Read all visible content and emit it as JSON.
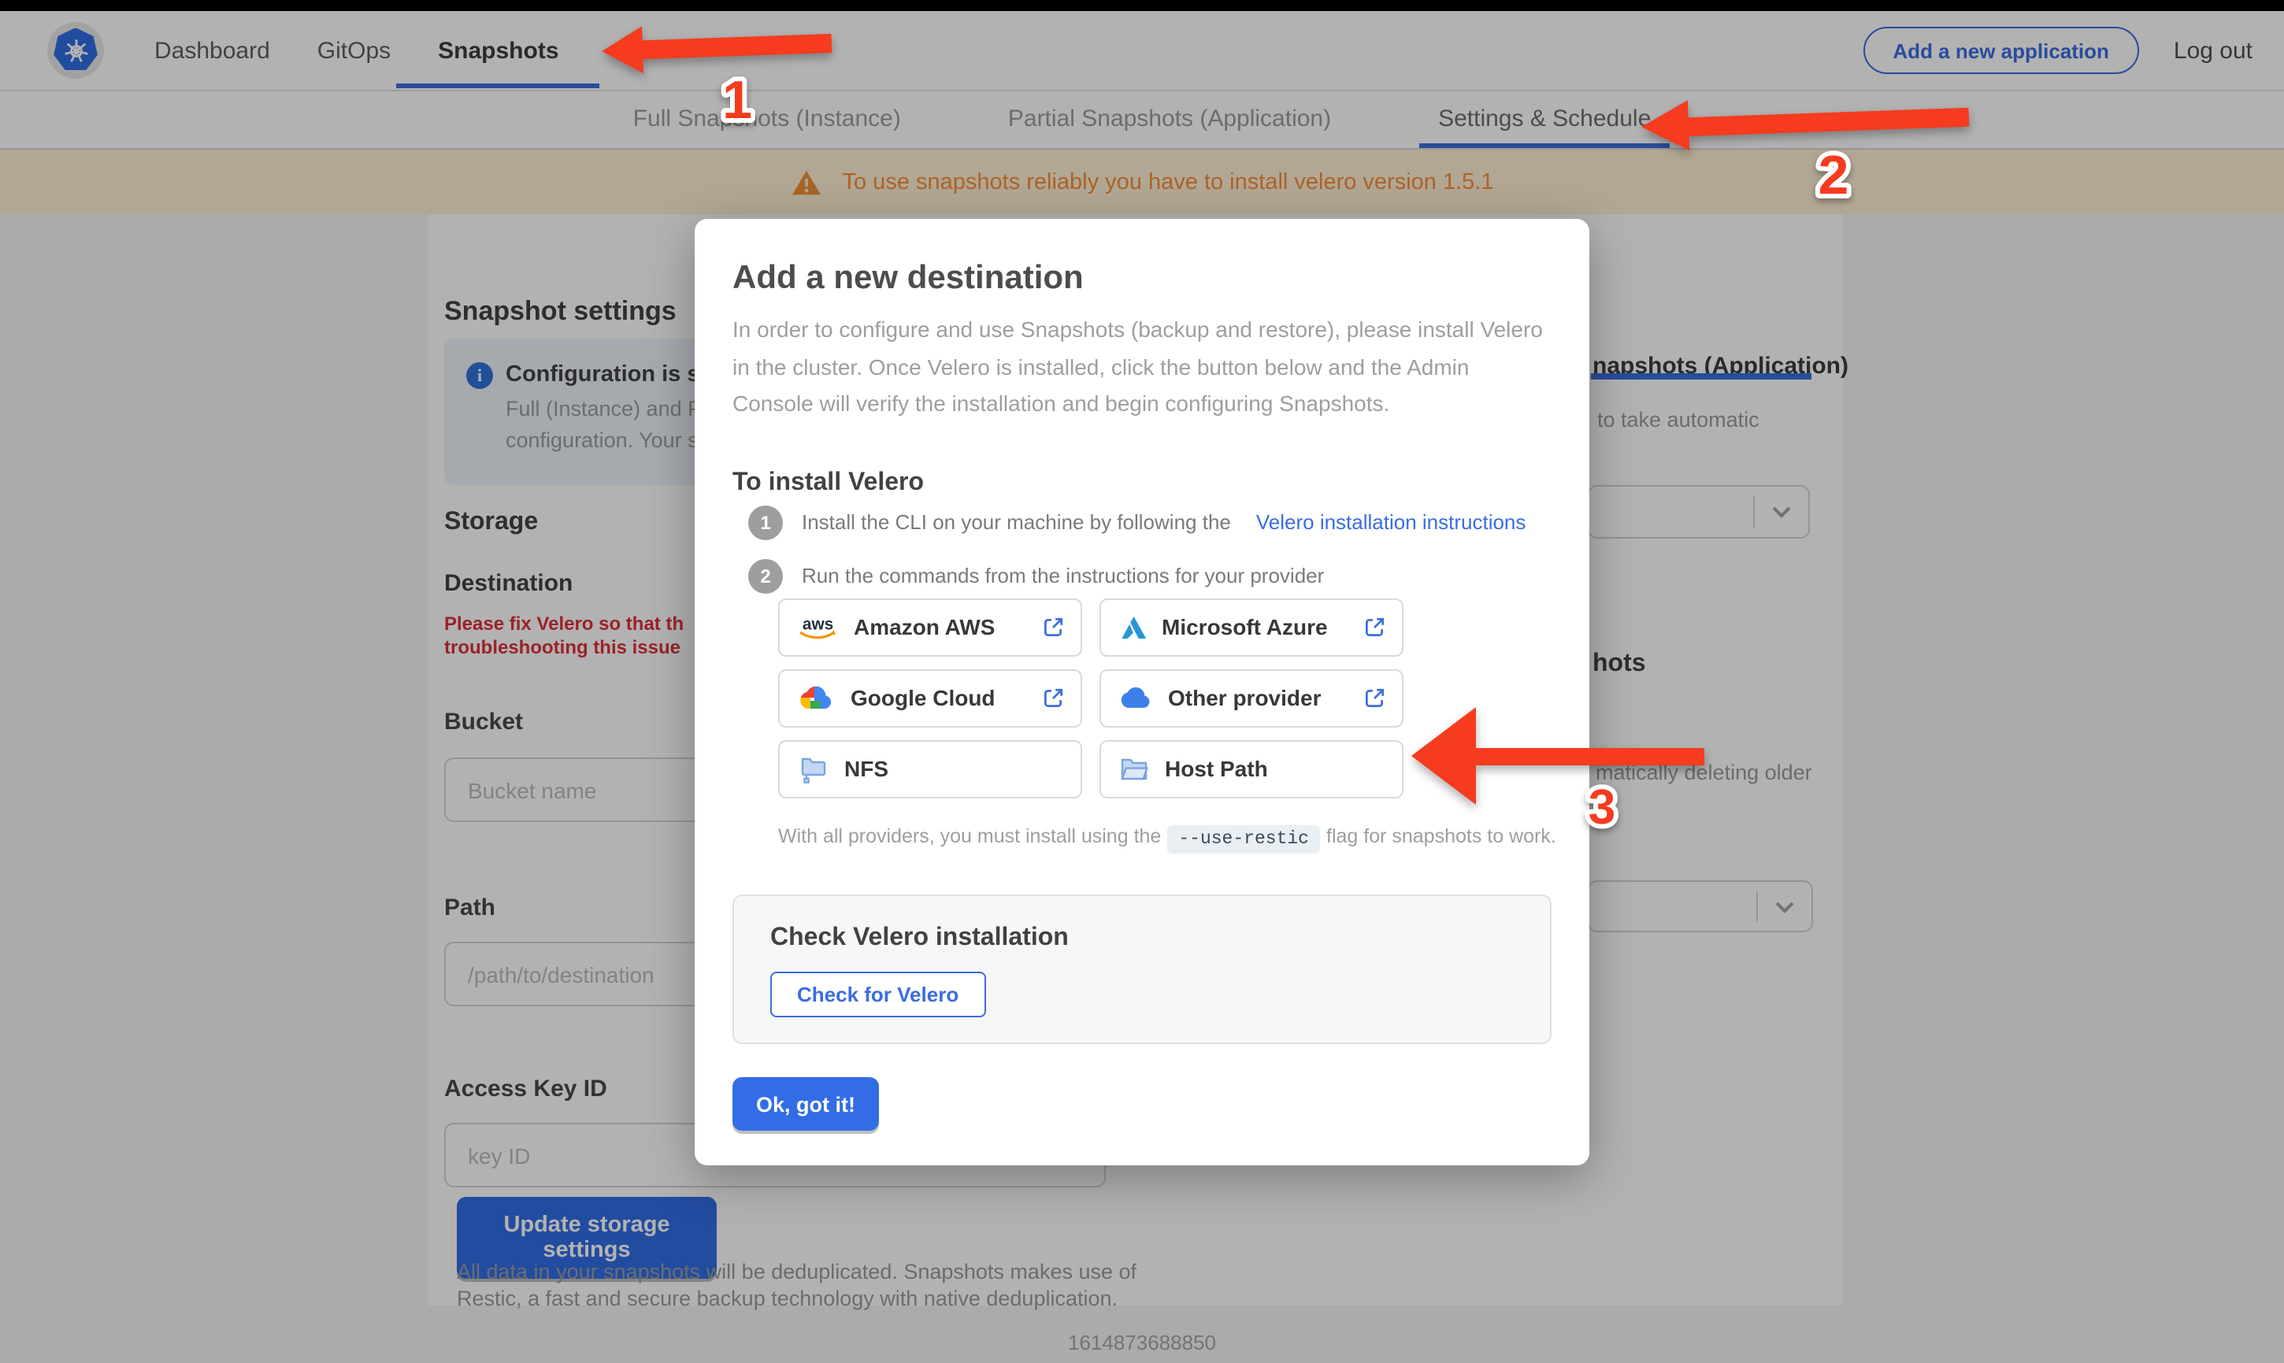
{
  "topnav": {
    "items": [
      {
        "label": "Dashboard"
      },
      {
        "label": "GitOps"
      },
      {
        "label": "Snapshots"
      }
    ],
    "active": "Snapshots",
    "add_application_label": "Add a new application",
    "logout_label": "Log out"
  },
  "tabs": {
    "items": [
      {
        "label": "Full Snapshots (Instance)"
      },
      {
        "label": "Partial Snapshots (Application)"
      },
      {
        "label": "Settings & Schedule"
      }
    ],
    "active": "Settings & Schedule"
  },
  "banner": {
    "text": "To use snapshots reliably you have to install velero version 1.5.1"
  },
  "settings_page": {
    "title": "Snapshot settings",
    "info_box": {
      "title_fragment": "Configuration is sh",
      "line1_fragment": "Full (Instance) and Parti",
      "line2_fragment": "configuration. Your stor"
    },
    "storage_heading": "Storage",
    "destination_heading": "Destination",
    "error_line1": "Please fix Velero so that th",
    "error_line2": "troubleshooting this issue",
    "fields": {
      "bucket_label": "Bucket",
      "bucket_placeholder": "Bucket name",
      "path_label": "Path",
      "path_placeholder": "/path/to/destination",
      "access_key_label": "Access Key ID",
      "access_key_placeholder": "key ID"
    },
    "update_button_label": "Update storage settings",
    "dedup_line1": "All data in your snapshots will be deduplicated. Snapshots makes use of",
    "dedup_line2": "Restic, a fast and secure backup technology with native deduplication.",
    "schedule_fragments": {
      "tab_fragment": "napshots (Application)",
      "interval_fragment": "to take automatic",
      "retention_heading_fragment": "hots",
      "retention_fragment": "matically deleting older"
    }
  },
  "modal": {
    "title": "Add a new destination",
    "body": "In order to configure and use Snapshots (backup and restore), please install Velero in the cluster. Once Velero is installed, click the button below and the Admin Console will verify the installation and begin configuring Snapshots.",
    "install_heading": "To install Velero",
    "steps": [
      {
        "number": "1",
        "text": "Install the CLI on your machine by following the",
        "link": "Velero installation instructions"
      },
      {
        "number": "2",
        "text": "Run the commands from the instructions for your provider"
      }
    ],
    "providers": [
      {
        "label": "Amazon AWS"
      },
      {
        "label": "Microsoft Azure"
      },
      {
        "label": "Google Cloud"
      },
      {
        "label": "Other provider"
      },
      {
        "label": "NFS"
      },
      {
        "label": "Host Path"
      }
    ],
    "restic_note_prefix": "With all providers, you must install using the",
    "restic_flag": "--use-restic",
    "restic_note_suffix": "flag for snapshots to work.",
    "check_section": {
      "heading": "Check Velero installation",
      "button_label": "Check for Velero"
    },
    "ok_button_label": "Ok, got it!"
  },
  "annotations": {
    "step1": "1",
    "step2": "2",
    "step3": "3"
  },
  "footer": {
    "timestamp": "1614873688850"
  },
  "colors": {
    "accent_blue": "#3a6de0",
    "arrow_red": "#f63b1e",
    "warning_orange": "#f68f3a",
    "error_red": "#dd3138"
  }
}
